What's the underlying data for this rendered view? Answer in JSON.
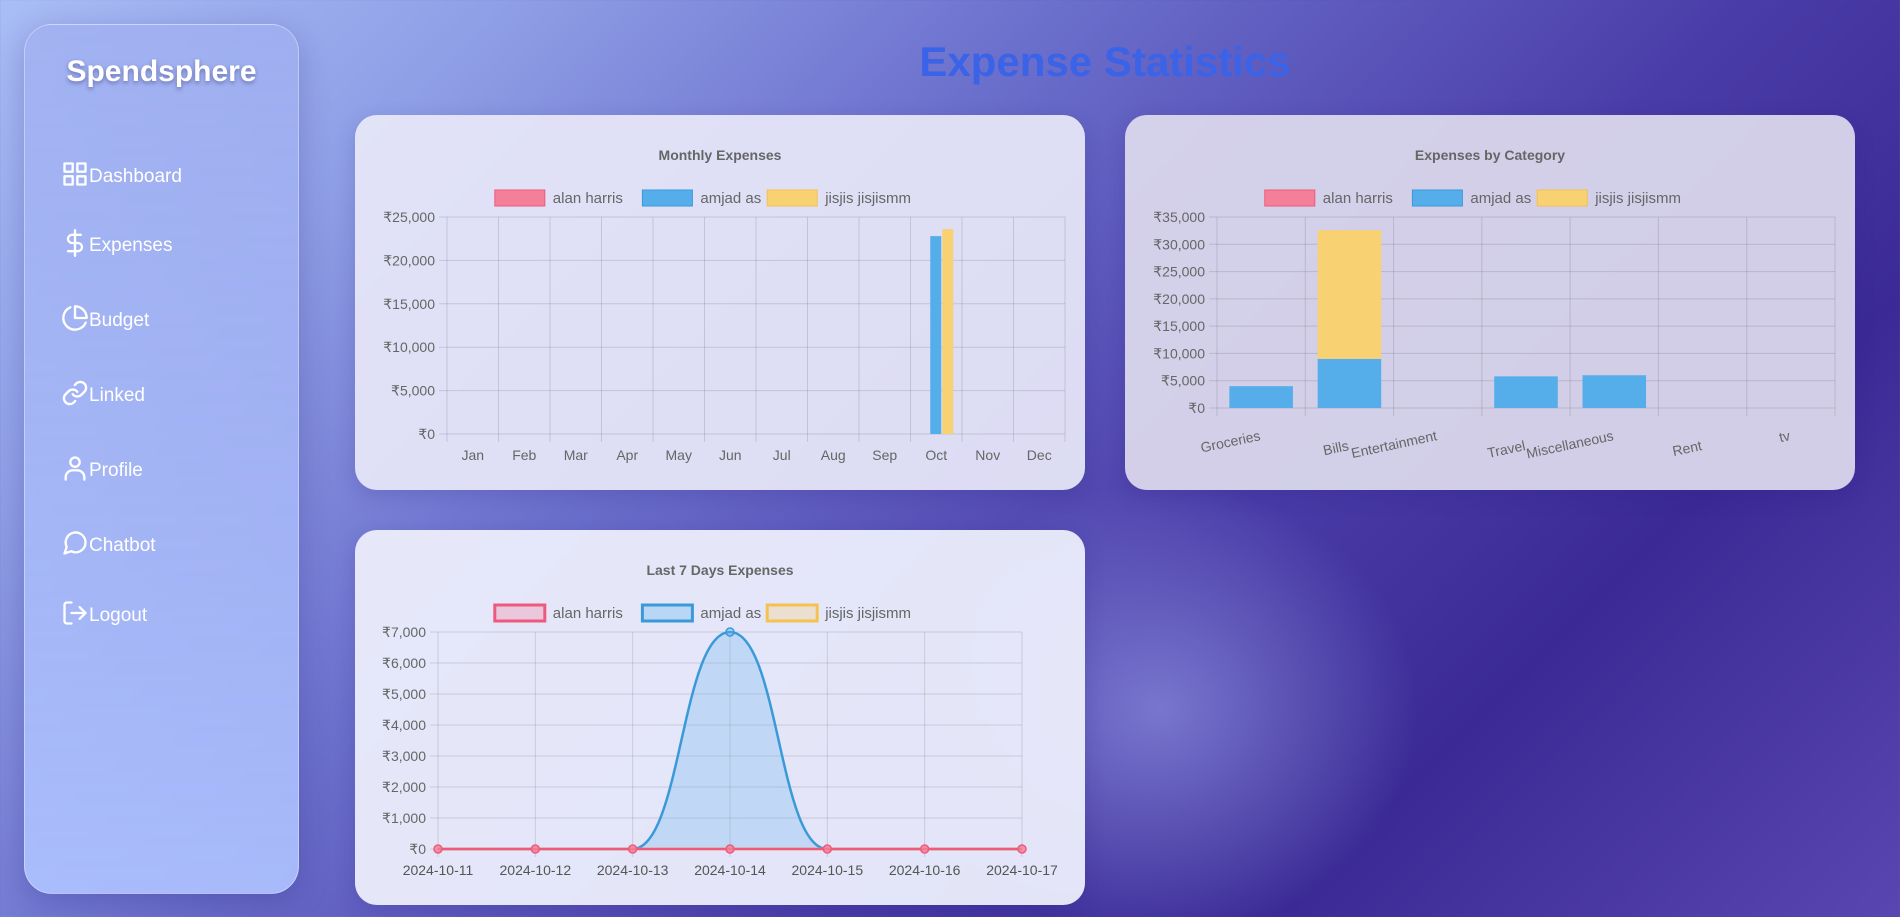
{
  "sidebar": {
    "brand": "Spendsphere",
    "items": [
      {
        "label": "Dashboard",
        "icon": "grid-icon"
      },
      {
        "label": "Expenses",
        "icon": "dollar-icon"
      },
      {
        "label": "Budget",
        "icon": "pie-chart-icon"
      },
      {
        "label": "Linked",
        "icon": "link-icon"
      },
      {
        "label": "Profile",
        "icon": "user-icon"
      },
      {
        "label": "Chatbot",
        "icon": "chat-bubble-icon"
      },
      {
        "label": "Logout",
        "icon": "logout-icon"
      }
    ]
  },
  "page_title": "Expense Statistics",
  "colors": {
    "alan": "#f47f98",
    "alan_border": "#ef5a7c",
    "amjad": "#55aeea",
    "amjad_border": "#3a9ad9",
    "jisjis": "#f8d173",
    "jisjis_border": "#f4c24d",
    "title": "#3a63e8"
  },
  "chart_data": [
    {
      "type": "bar",
      "title": "Monthly Expenses",
      "categories": [
        "Jan",
        "Feb",
        "Mar",
        "Apr",
        "May",
        "Jun",
        "Jul",
        "Aug",
        "Sep",
        "Oct",
        "Nov",
        "Dec"
      ],
      "series": [
        {
          "name": "alan harris",
          "values": [
            0,
            0,
            0,
            0,
            0,
            0,
            0,
            0,
            0,
            0,
            0,
            0
          ]
        },
        {
          "name": "amjad as",
          "values": [
            0,
            0,
            0,
            0,
            0,
            0,
            0,
            0,
            0,
            22800,
            0,
            0
          ]
        },
        {
          "name": "jisjis jisjismm",
          "values": [
            0,
            0,
            0,
            0,
            0,
            0,
            0,
            0,
            0,
            23600,
            0,
            0
          ]
        }
      ],
      "ylim": [
        0,
        25000
      ],
      "yticks": [
        "₹0",
        "₹5,000",
        "₹10,000",
        "₹15,000",
        "₹20,000",
        "₹25,000"
      ],
      "legend": "top",
      "grid": true
    },
    {
      "type": "bar",
      "stacked": true,
      "title": "Expenses by Category",
      "categories": [
        "Groceries",
        "Bills",
        "Entertainment",
        "Travel",
        "Miscellaneous",
        "Rent",
        "tv"
      ],
      "series": [
        {
          "name": "alan harris",
          "values": [
            0,
            0,
            0,
            0,
            0,
            0,
            0
          ]
        },
        {
          "name": "amjad as",
          "values": [
            4000,
            9000,
            0,
            5800,
            6000,
            0,
            0
          ]
        },
        {
          "name": "jisjis jisjismm",
          "values": [
            0,
            23600,
            0,
            0,
            0,
            0,
            0
          ]
        }
      ],
      "ylim": [
        0,
        35000
      ],
      "yticks": [
        "₹0",
        "₹5,000",
        "₹10,000",
        "₹15,000",
        "₹20,000",
        "₹25,000",
        "₹30,000",
        "₹35,000"
      ],
      "legend": "top",
      "grid": true
    },
    {
      "type": "line",
      "title": "Last 7 Days Expenses",
      "categories": [
        "2024-10-11",
        "2024-10-12",
        "2024-10-13",
        "2024-10-14",
        "2024-10-15",
        "2024-10-16",
        "2024-10-17"
      ],
      "series": [
        {
          "name": "alan harris",
          "values": [
            0,
            0,
            0,
            0,
            0,
            0,
            0
          ]
        },
        {
          "name": "amjad as",
          "values": [
            0,
            0,
            0,
            7000,
            0,
            0,
            0
          ],
          "filled": true
        },
        {
          "name": "jisjis jisjismm",
          "values": [
            0,
            0,
            0,
            0,
            0,
            0,
            0
          ]
        }
      ],
      "ylim": [
        0,
        7000
      ],
      "yticks": [
        "₹0",
        "₹1,000",
        "₹2,000",
        "₹3,000",
        "₹4,000",
        "₹5,000",
        "₹6,000",
        "₹7,000"
      ],
      "legend": "top",
      "grid": true
    }
  ]
}
